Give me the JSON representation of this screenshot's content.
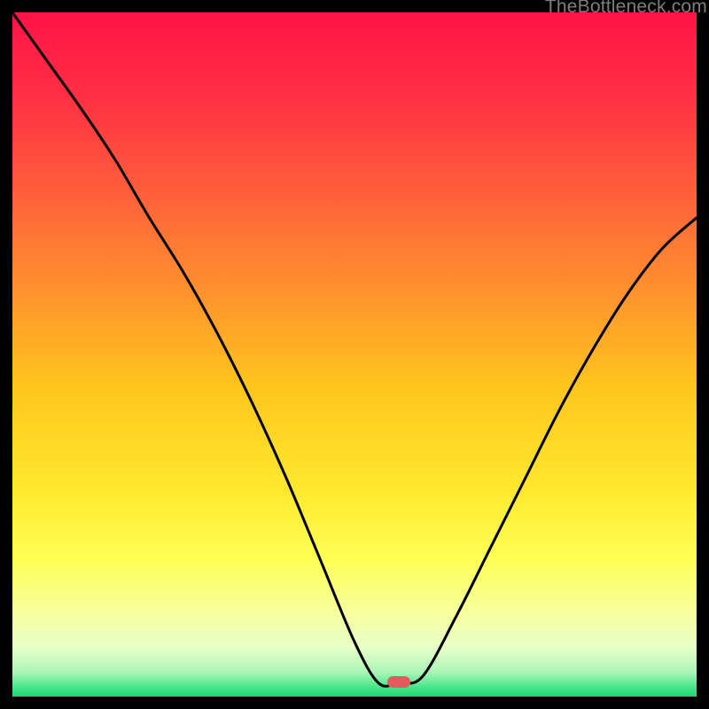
{
  "watermark": "TheBottleneck.com",
  "marker": {
    "color": "#E55A5A",
    "x_frac": 0.565,
    "y_frac": 0.978,
    "w": 26,
    "h": 13
  },
  "gradient_stops": [
    {
      "offset": 0.0,
      "color": "#FF1447"
    },
    {
      "offset": 0.12,
      "color": "#FF2E44"
    },
    {
      "offset": 0.25,
      "color": "#FF5A3B"
    },
    {
      "offset": 0.4,
      "color": "#FF8F2F"
    },
    {
      "offset": 0.55,
      "color": "#FFC61E"
    },
    {
      "offset": 0.7,
      "color": "#FFE92E"
    },
    {
      "offset": 0.8,
      "color": "#FFFF55"
    },
    {
      "offset": 0.88,
      "color": "#F7FFA0"
    },
    {
      "offset": 0.93,
      "color": "#E6FFC8"
    },
    {
      "offset": 0.965,
      "color": "#A8F5B8"
    },
    {
      "offset": 0.985,
      "color": "#4EE68C"
    },
    {
      "offset": 1.0,
      "color": "#18D873"
    }
  ],
  "chart_data": {
    "type": "line",
    "title": "",
    "xlabel": "",
    "ylabel": "",
    "xlim": [
      0,
      1
    ],
    "ylim": [
      0,
      1
    ],
    "note": "x and y are normalized fractions of the plot area (origin bottom-left); y ≈ bottleneck magnitude (1=max red, 0=green/optimal).",
    "series": [
      {
        "name": "bottleneck-curve",
        "x": [
          0.0,
          0.05,
          0.1,
          0.15,
          0.2,
          0.25,
          0.3,
          0.35,
          0.4,
          0.45,
          0.5,
          0.535,
          0.565,
          0.6,
          0.65,
          0.7,
          0.75,
          0.8,
          0.85,
          0.9,
          0.95,
          1.0
        ],
        "y": [
          1.0,
          0.93,
          0.86,
          0.785,
          0.7,
          0.62,
          0.53,
          0.43,
          0.32,
          0.2,
          0.08,
          0.02,
          0.02,
          0.03,
          0.12,
          0.22,
          0.32,
          0.42,
          0.51,
          0.59,
          0.655,
          0.7
        ]
      }
    ]
  }
}
